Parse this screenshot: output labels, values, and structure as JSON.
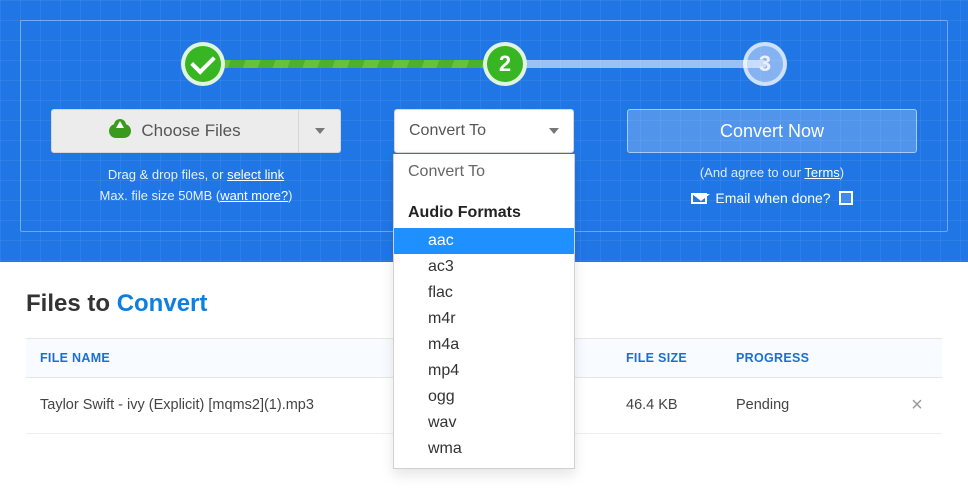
{
  "stepper": {
    "step2": "2",
    "step3": "3"
  },
  "choose": {
    "label": "Choose Files",
    "hint_prefix": "Drag & drop files, or ",
    "hint_link": "select link",
    "max_prefix": "Max. file size 50MB (",
    "max_link": "want more?",
    "max_suffix": ")"
  },
  "convert": {
    "button": "Convert To",
    "dd_title": "Convert To",
    "group": "Audio Formats",
    "options": [
      "aac",
      "ac3",
      "flac",
      "m4r",
      "m4a",
      "mp4",
      "ogg",
      "wav",
      "wma"
    ],
    "selected": "aac"
  },
  "now": {
    "button": "Convert Now",
    "terms_prefix": "(And agree to our ",
    "terms_link": "Terms",
    "terms_suffix": ")",
    "email_label": "Email when done?"
  },
  "list": {
    "heading_a": "Files to ",
    "heading_b": "Convert",
    "cols": {
      "name": "FILE NAME",
      "size": "FILE SIZE",
      "progress": "PROGRESS"
    },
    "rows": [
      {
        "name": "Taylor Swift - ivy (Explicit) [mqms2](1).mp3",
        "size": "46.4 KB",
        "progress": "Pending"
      }
    ]
  }
}
